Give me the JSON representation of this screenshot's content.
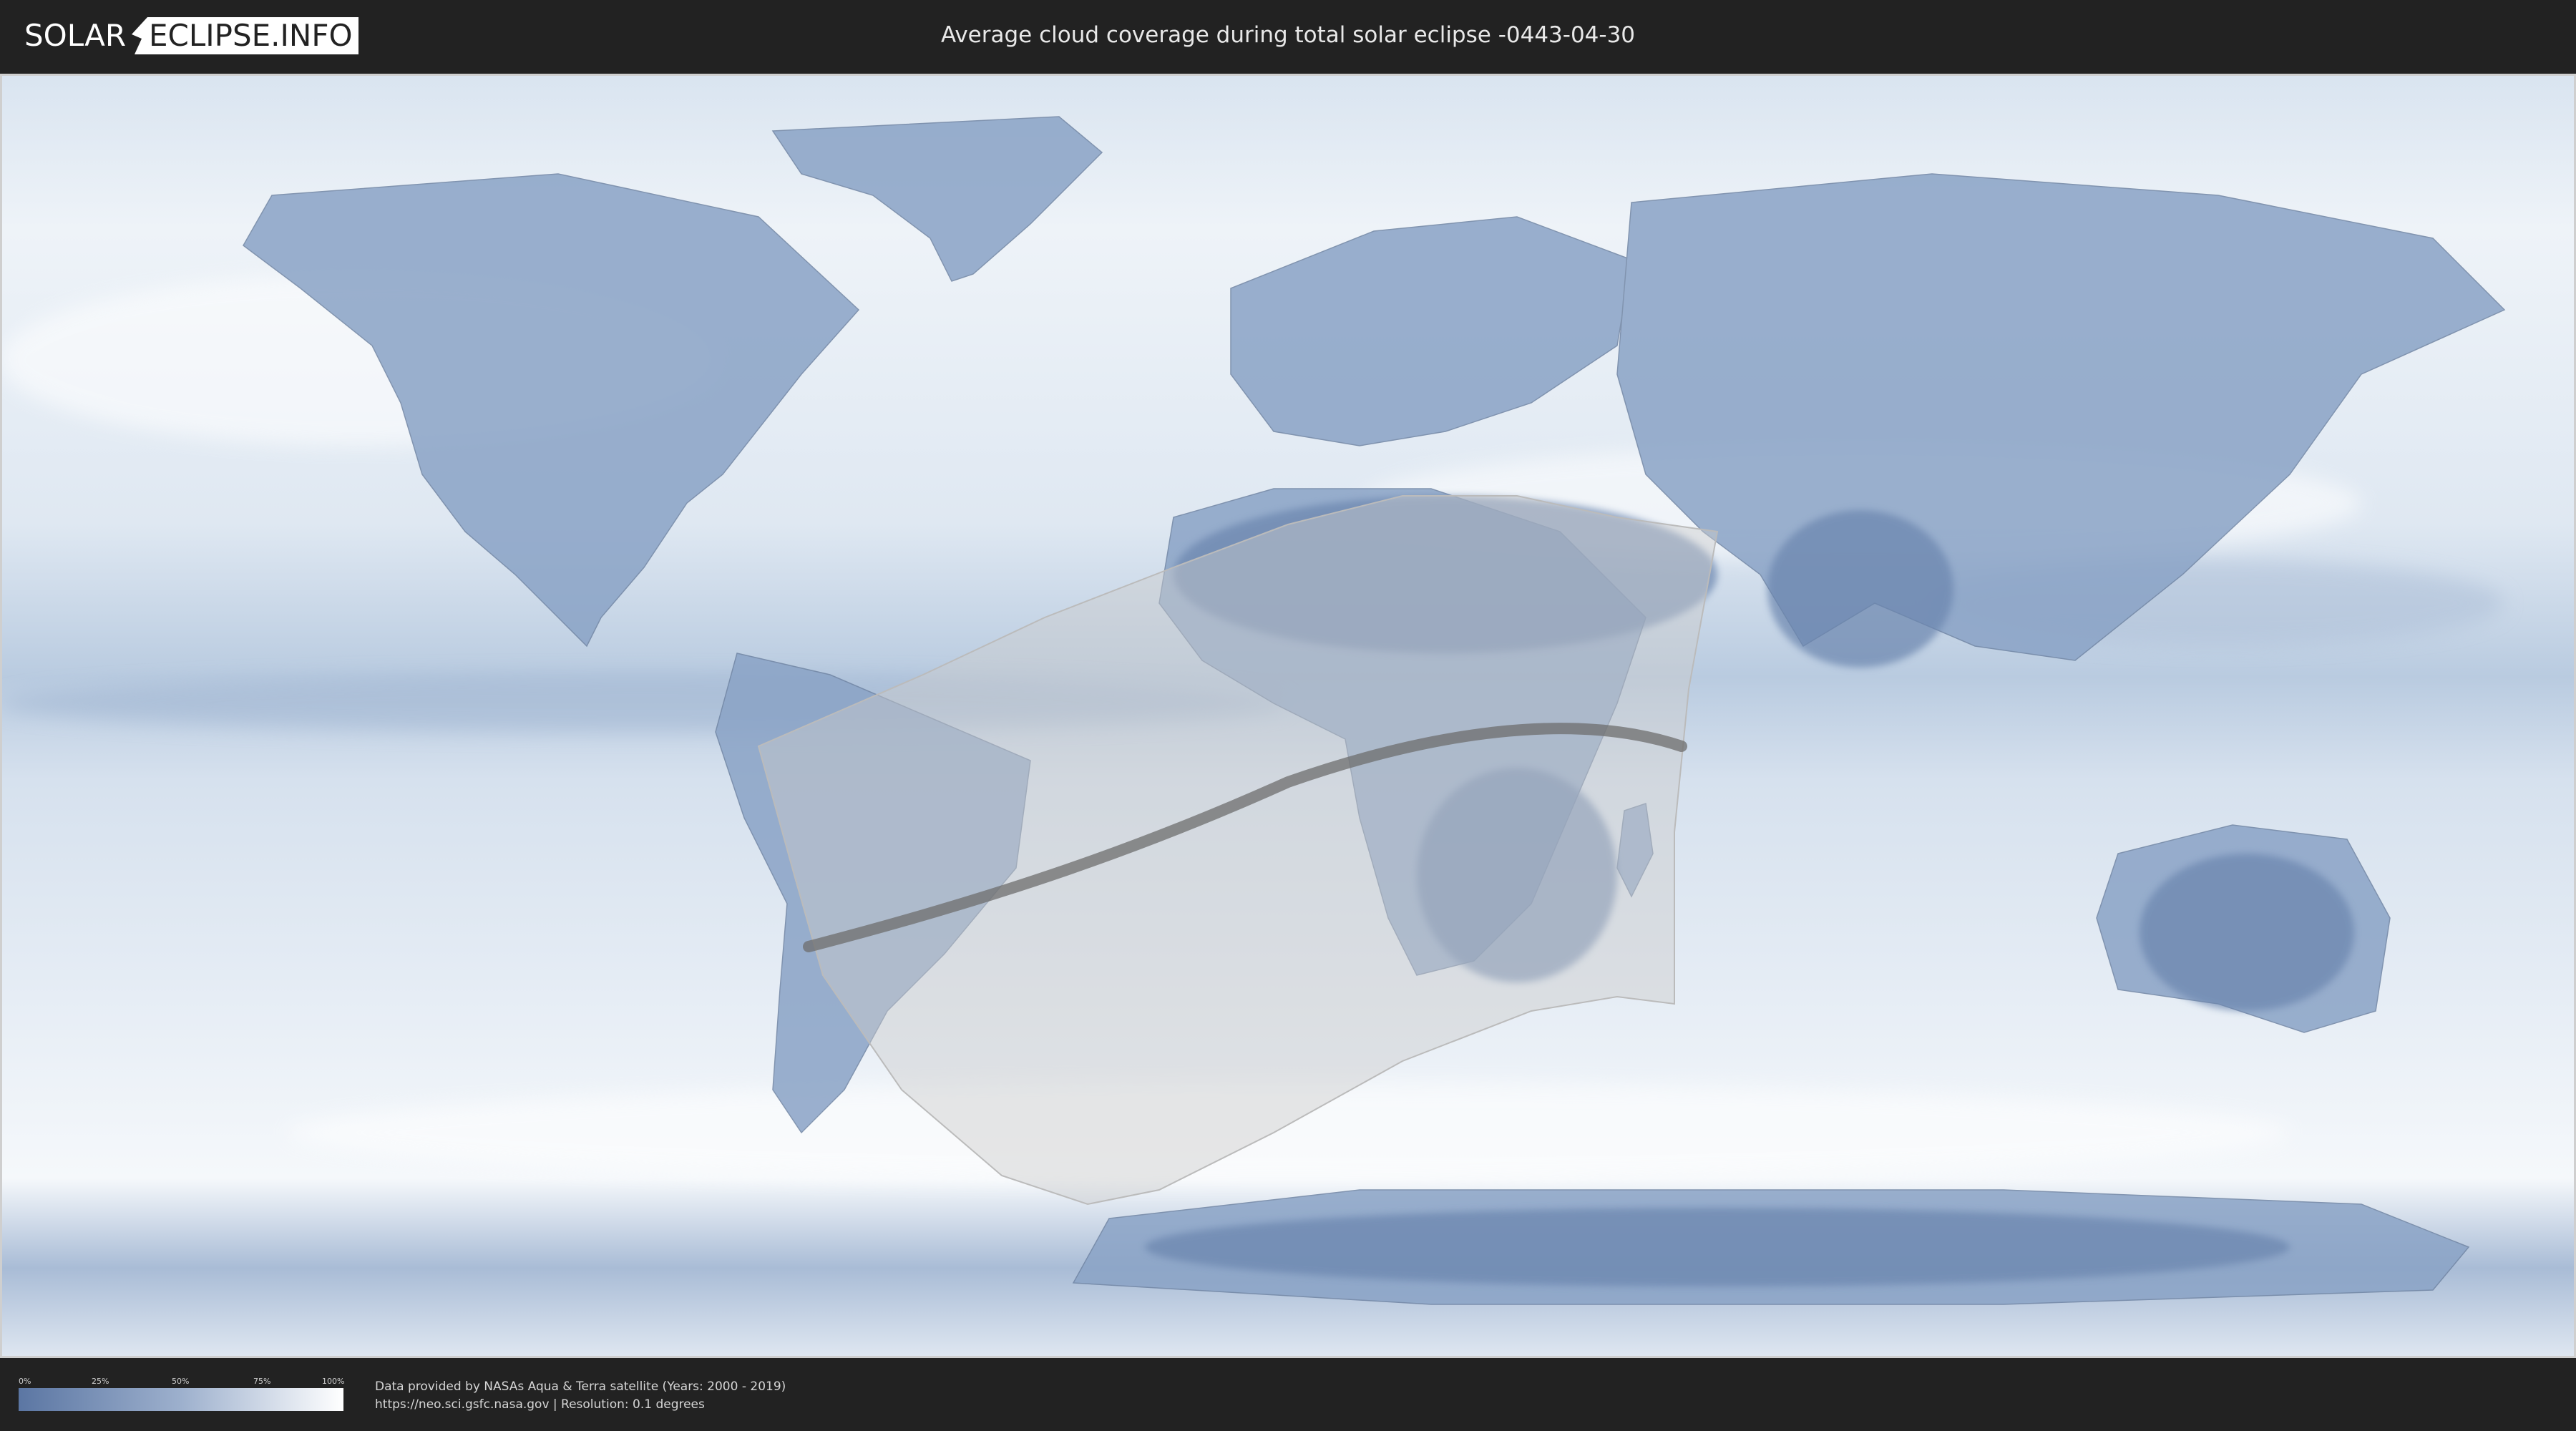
{
  "header": {
    "brand_left": "SOLAR",
    "brand_right": "ECLIPSE.INFO",
    "title": "Average cloud coverage during total solar eclipse -0443-04-30"
  },
  "map": {
    "description_layer": "cloud-coverage",
    "colors": {
      "clear": "#5b76a3",
      "cloudy": "#ffffff",
      "path": "#6e6e6e",
      "region": "#cccccc"
    }
  },
  "legend": {
    "ticks": [
      "0%",
      "25%",
      "50%",
      "75%",
      "100%"
    ],
    "tick_values": [
      0,
      25,
      50,
      75,
      100
    ]
  },
  "credits": {
    "line1": "Data provided by NASAs Aqua & Terra satellite (Years: 2000 - 2019)",
    "line2": "https://neo.sci.gsfc.nasa.gov | Resolution: 0.1 degrees"
  }
}
